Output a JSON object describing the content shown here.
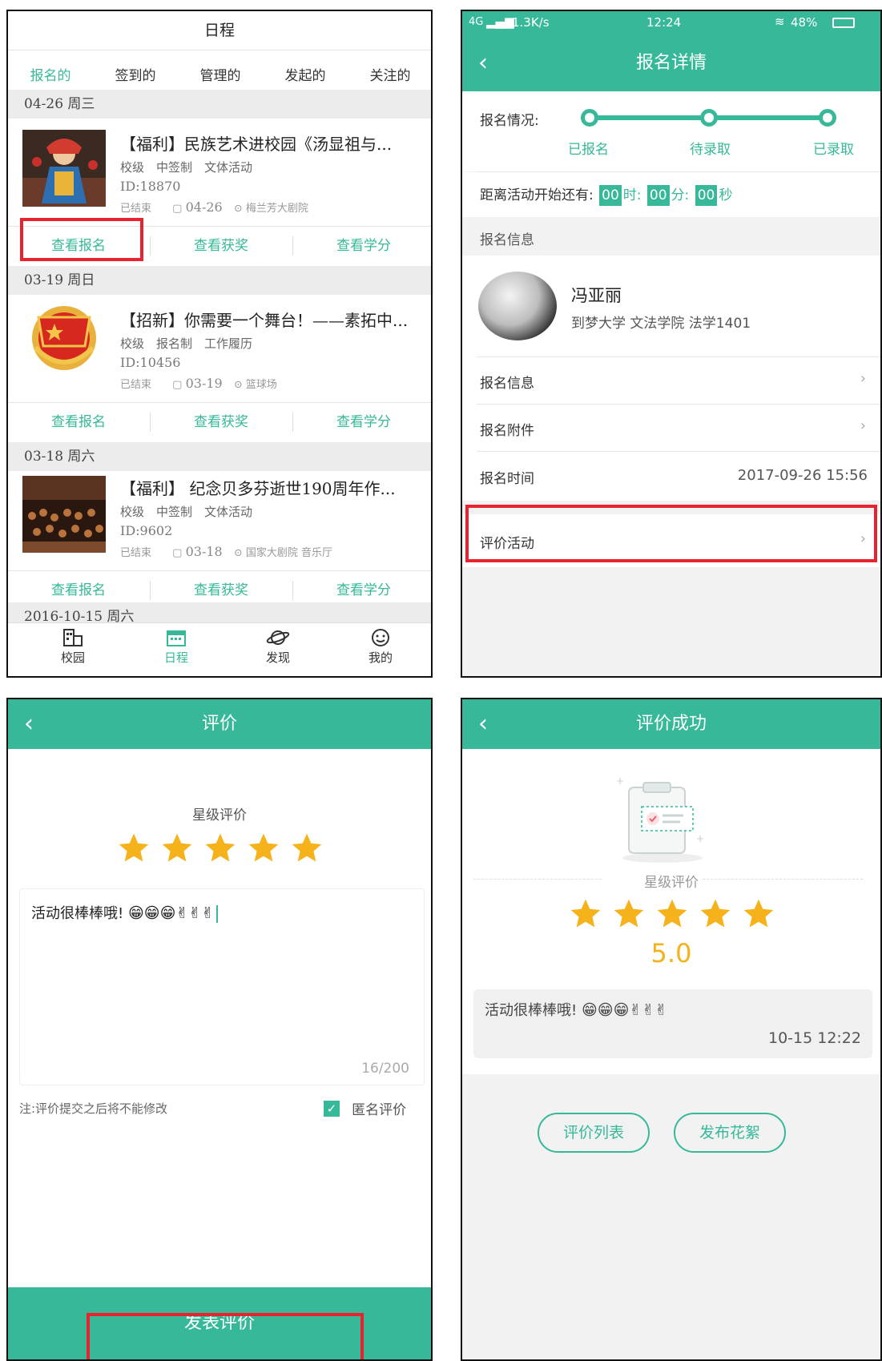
{
  "schedule": {
    "title": "日程",
    "tabs": [
      "报名的",
      "签到的",
      "管理的",
      "发起的",
      "关注的"
    ],
    "groups": [
      {
        "date": "04-26 周三",
        "card": {
          "title": "【福利】民族艺术进校园《汤显祖与...",
          "meta": "校级　中签制　文体活动",
          "id": "ID:18870",
          "status": "已结束",
          "day": "04-26",
          "place": "梅兰芳大剧院"
        },
        "actions": [
          "查看报名",
          "查看获奖",
          "查看学分"
        ]
      },
      {
        "date": "03-19 周日",
        "card": {
          "title": "【招新】你需要一个舞台！——素拓中...",
          "meta": "校级　报名制　工作履历",
          "id": "ID:10456",
          "status": "已结束",
          "day": "03-19",
          "place": "篮球场"
        },
        "actions": [
          "查看报名",
          "查看获奖",
          "查看学分"
        ]
      },
      {
        "date": "03-18 周六",
        "card": {
          "title": "【福利】 纪念贝多芬逝世190周年作...",
          "meta": "校级　中签制　文体活动",
          "id": "ID:9602",
          "status": "已结束",
          "day": "03-18",
          "place": "国家大剧院 音乐厅"
        },
        "actions": [
          "查看报名",
          "查看获奖",
          "查看学分"
        ]
      }
    ],
    "next_date": "2016-10-15 周六",
    "tabbar": [
      "校园",
      "日程",
      "发现",
      "我的"
    ]
  },
  "detail": {
    "status_bar": {
      "network": "4G",
      "speed": "1.3K/s",
      "time": "12:24",
      "battery": "48%"
    },
    "title": "报名详情",
    "progress_label": "报名情况:",
    "steps": [
      "已报名",
      "待录取",
      "已录取"
    ],
    "countdown_label": "距离活动开始还有:",
    "countdown": {
      "h": "00",
      "h_unit": "时:",
      "m": "00",
      "m_unit": "分:",
      "s": "00",
      "s_unit": "秒"
    },
    "section_title": "报名信息",
    "user_name": "冯亚丽",
    "user_school": "到梦大学 文法学院 法学1401",
    "rows": [
      {
        "label": "报名信息"
      },
      {
        "label": "报名附件"
      }
    ],
    "time_label": "报名时间",
    "time_value": "2017-09-26 15:56",
    "evaluate_label": "评价活动"
  },
  "evaluate": {
    "title": "评价",
    "star_label": "星级评价",
    "rating": 5,
    "comment": "活动很棒棒哦!",
    "emojis": "😁😁😁✌✌✌",
    "counter": "16/200",
    "note": "注:评价提交之后将不能修改",
    "anonymous_label": "匿名评价",
    "anonymous_checked": true,
    "submit_label": "发表评价"
  },
  "success": {
    "title": "评价成功",
    "star_label": "星级评价",
    "rating": 5,
    "score": "5.0",
    "comment": "活动很棒棒哦!",
    "emojis": "😁😁😁✌✌✌",
    "time": "10-15 12:22",
    "btn_list": "评价列表",
    "btn_post": "发布花絮"
  },
  "colors": {
    "accent": "#36b899",
    "highlight": "#e8232f",
    "star": "#f5b21b"
  }
}
